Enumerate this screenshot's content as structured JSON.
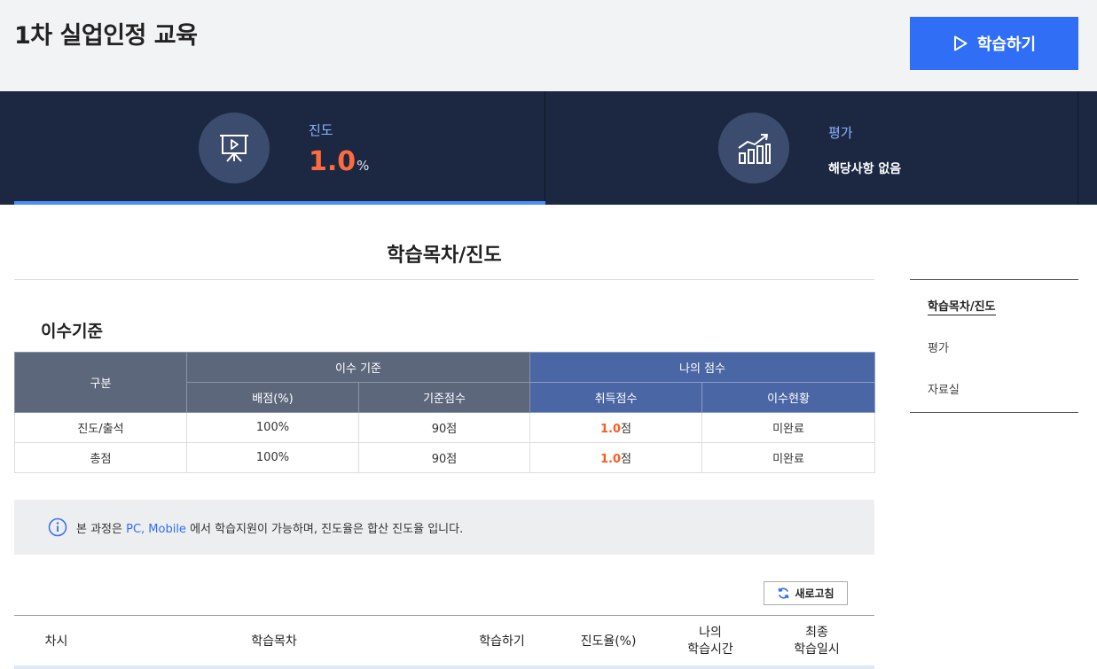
{
  "header": {
    "course_title": "1차 실업인정 교육",
    "study_button": "학습하기"
  },
  "stats": {
    "progress": {
      "label": "진도",
      "value": "1.0",
      "unit": "%"
    },
    "evaluation": {
      "label": "평가",
      "value": "해당사항 없음"
    }
  },
  "section": {
    "title": "학습목차/진도"
  },
  "side_nav": {
    "items": [
      {
        "label": "학습목차/진도",
        "active": true
      },
      {
        "label": "평가"
      },
      {
        "label": "자료실"
      }
    ]
  },
  "criteria": {
    "title": "이수기준",
    "headers": {
      "category": "구분",
      "criteria_group": "이수 기준",
      "my_score_group": "나의 점수",
      "weight": "배점(%)",
      "base_score": "기준점수",
      "earned_score": "취득점수",
      "status": "이수현황"
    },
    "rows": [
      {
        "category": "진도/출석",
        "weight": "100%",
        "base_score": "90점",
        "earned": "1.0",
        "earned_unit": "점",
        "status": "미완료"
      },
      {
        "category": "총점",
        "weight": "100%",
        "base_score": "90점",
        "earned": "1.0",
        "earned_unit": "점",
        "status": "미완료"
      }
    ]
  },
  "notice": {
    "prefix": "본 과정은 ",
    "highlight": "PC, Mobile",
    "suffix": " 에서 학습지원이 가능하며, 진도율은 합산 진도율 입니다."
  },
  "lesson_list": {
    "refresh_button": "새로고침",
    "headers": {
      "session": "차시",
      "contents": "학습목차",
      "study": "학습하기",
      "progress": "진도율(%)",
      "my_time_1": "나의",
      "my_time_2": "학습시간",
      "last_date_1": "최종",
      "last_date_2": "학습일시"
    }
  },
  "colors": {
    "primary": "#2f6ef5",
    "stats_bg": "#1c2842",
    "accent_orange": "#ff6b3d"
  }
}
